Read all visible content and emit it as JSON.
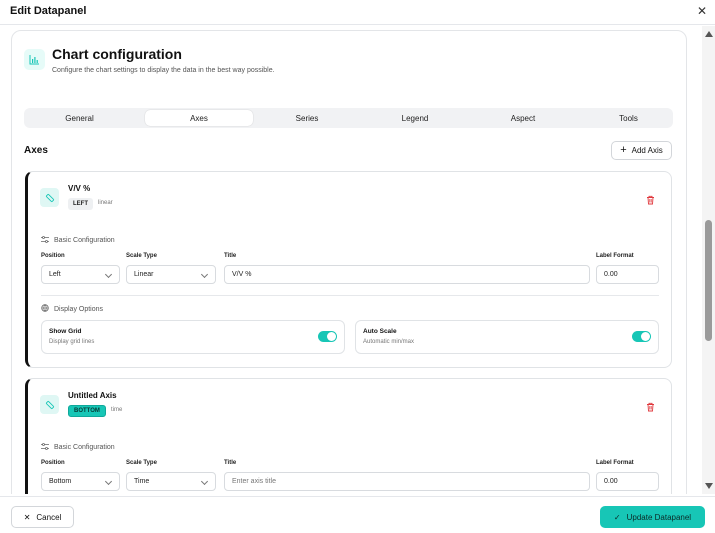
{
  "dialog": {
    "title": "Edit Datapanel",
    "close_icon": "close-icon"
  },
  "header": {
    "icon": "bar-chart-icon",
    "title": "Chart configuration",
    "subtitle": "Configure the chart settings to display the data in the best way possible."
  },
  "tabs": {
    "items": [
      "General",
      "Axes",
      "Series",
      "Legend",
      "Aspect",
      "Tools"
    ],
    "active": "Axes"
  },
  "axes_section": {
    "title": "Axes",
    "add_label": "Add Axis"
  },
  "axis1": {
    "name": "V/V %",
    "badge": "LEFT",
    "scale_type_tag": "linear",
    "basic_config_label": "Basic Configuration",
    "position_label": "Position",
    "position_value": "Left",
    "scale_type_label": "Scale Type",
    "scale_type_value": "Linear",
    "title_label": "Title",
    "title_value": "V/V %",
    "label_format_label": "Label Format",
    "label_format_value": "0.00",
    "display_options_label": "Display Options",
    "show_grid_title": "Show Grid",
    "show_grid_sub": "Display grid lines",
    "auto_scale_title": "Auto Scale",
    "auto_scale_sub": "Automatic min/max",
    "show_grid_on": true,
    "auto_scale_on": true
  },
  "axis2": {
    "name": "Untitled Axis",
    "badge": "BOTTOM",
    "scale_type_tag": "time",
    "basic_config_label": "Basic Configuration",
    "position_label": "Position",
    "position_value": "Bottom",
    "scale_type_label": "Scale Type",
    "scale_type_value": "Time",
    "title_label": "Title",
    "title_placeholder": "Enter axis title",
    "label_format_label": "Label Format",
    "label_format_value": "0.00"
  },
  "footer": {
    "cancel_label": "Cancel",
    "update_label": "Update Datapanel"
  },
  "colors": {
    "accent": "#17c6b6",
    "danger": "#e0393e"
  }
}
